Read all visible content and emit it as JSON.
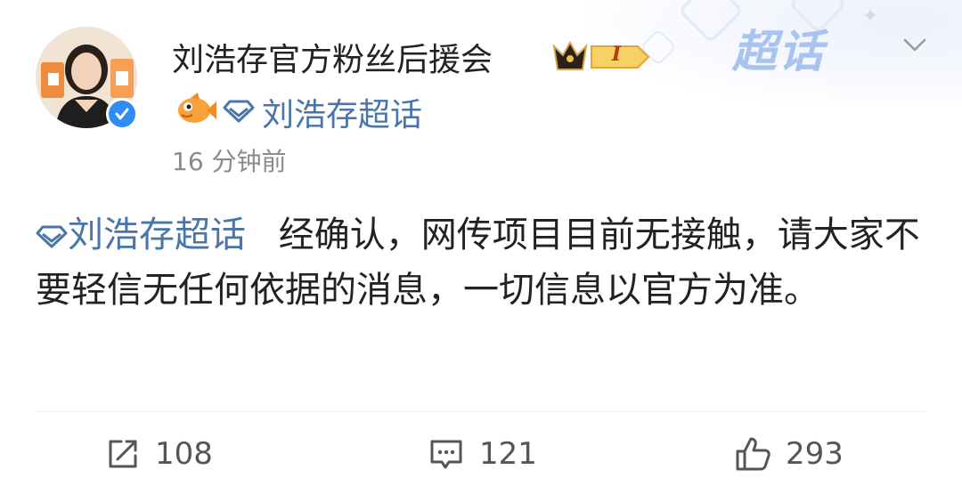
{
  "header": {
    "username": "刘浩存官方粉丝后援会",
    "level_badge": "I",
    "topic_name": "刘浩存超话",
    "timestamp": "16 分钟前",
    "chaohua_mark": "超话"
  },
  "post": {
    "topic_tag": "刘浩存超话",
    "body": "经确认，网传项目目前无接触，请大家不要轻信无任何依据的消息，一切信息以官方为准。"
  },
  "actions": {
    "repost_count": "108",
    "comment_count": "121",
    "like_count": "293"
  },
  "colors": {
    "link": "#4a75a8",
    "verified": "#2f8cf4",
    "muted": "#8a8a8a"
  },
  "icons": [
    "chevron-down-icon",
    "verified-icon",
    "crown-badge-icon",
    "fish-icon",
    "diamond-icon",
    "repost-icon",
    "comment-icon",
    "like-icon"
  ]
}
